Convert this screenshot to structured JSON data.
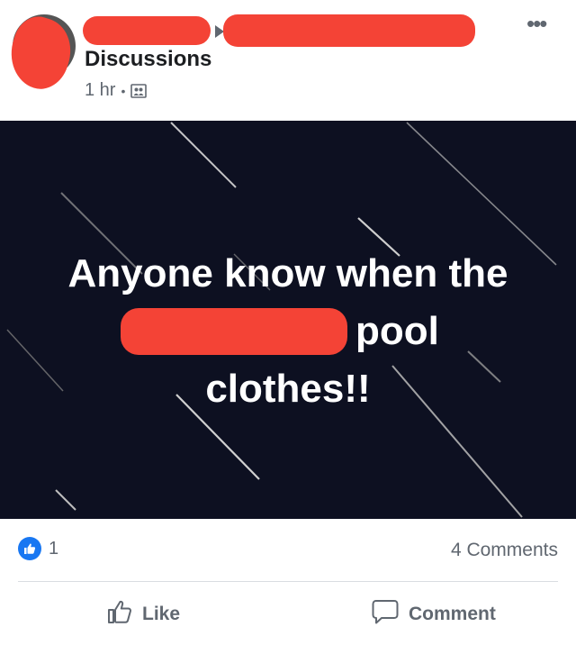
{
  "post": {
    "group_name": "Discussions",
    "time": "1 hr",
    "separator": "•",
    "audience_icon": "group-icon",
    "more_icon": "more-horizontal-icon",
    "more_glyph": "•••",
    "text": {
      "line1": "Anyone know when the",
      "line2_word": "pool",
      "line3": "clothes!!"
    },
    "background_color": "#0d1021"
  },
  "reactions": {
    "icon": "like-icon",
    "count": "1",
    "comments": "4 Comments"
  },
  "actions": {
    "like_label": "Like",
    "comment_label": "Comment"
  },
  "colors": {
    "redaction": "#f44336",
    "like_blue": "#1877f2",
    "text_gray": "#606770"
  }
}
